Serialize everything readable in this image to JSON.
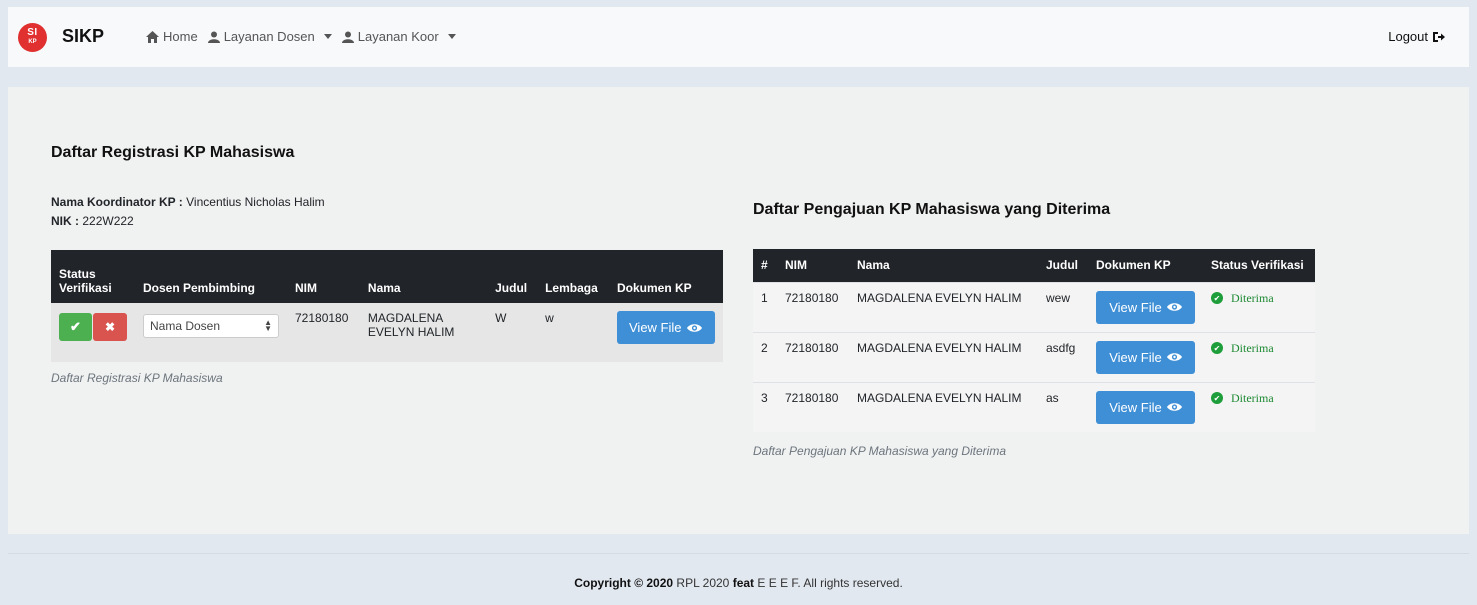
{
  "nav": {
    "logo_top": "SI",
    "logo_bottom": "KP",
    "brand": "SIKP",
    "home": "Home",
    "layanan_dosen": "Layanan Dosen",
    "layanan_koor": "Layanan Koor",
    "logout": "Logout"
  },
  "left": {
    "title": "Daftar Registrasi KP Mahasiswa",
    "koordinator_label": "Nama Koordinator KP :",
    "koordinator_value": "Vincentius Nicholas Halim",
    "nik_label": "NIK :",
    "nik_value": "222W222",
    "headers": [
      "Status Verifikasi",
      "Dosen Pembimbing",
      "NIM",
      "Nama",
      "Judul",
      "Lembaga",
      "Dokumen KP"
    ],
    "row": {
      "select_value": "Nama Dosen",
      "nim": "72180180",
      "nama": "MAGDALENA EVELYN HALIM",
      "judul": "W",
      "lembaga": "w",
      "view_label": "View File"
    },
    "caption": "Daftar Registrasi KP Mahasiswa"
  },
  "right": {
    "title": "Daftar Pengajuan KP Mahasiswa yang Diterima",
    "headers": [
      "#",
      "NIM",
      "Nama",
      "Judul",
      "Dokumen KP",
      "Status Verifikasi"
    ],
    "rows": [
      {
        "no": "1",
        "nim": "72180180",
        "nama": "MAGDALENA EVELYN HALIM",
        "judul": "wew",
        "view_label": "View File",
        "status": "Diterima"
      },
      {
        "no": "2",
        "nim": "72180180",
        "nama": "MAGDALENA EVELYN HALIM",
        "judul": "asdfg",
        "view_label": "View File",
        "status": "Diterima"
      },
      {
        "no": "3",
        "nim": "72180180",
        "nama": "MAGDALENA EVELYN HALIM",
        "judul": "as",
        "view_label": "View File",
        "status": "Diterima"
      }
    ],
    "caption": "Daftar Pengajuan KP Mahasiswa yang Diterima"
  },
  "footer": {
    "copyright": "Copyright © 2020",
    "middle": "RPL 2020",
    "feat": "feat",
    "rest": "E E E F. All rights reserved."
  }
}
